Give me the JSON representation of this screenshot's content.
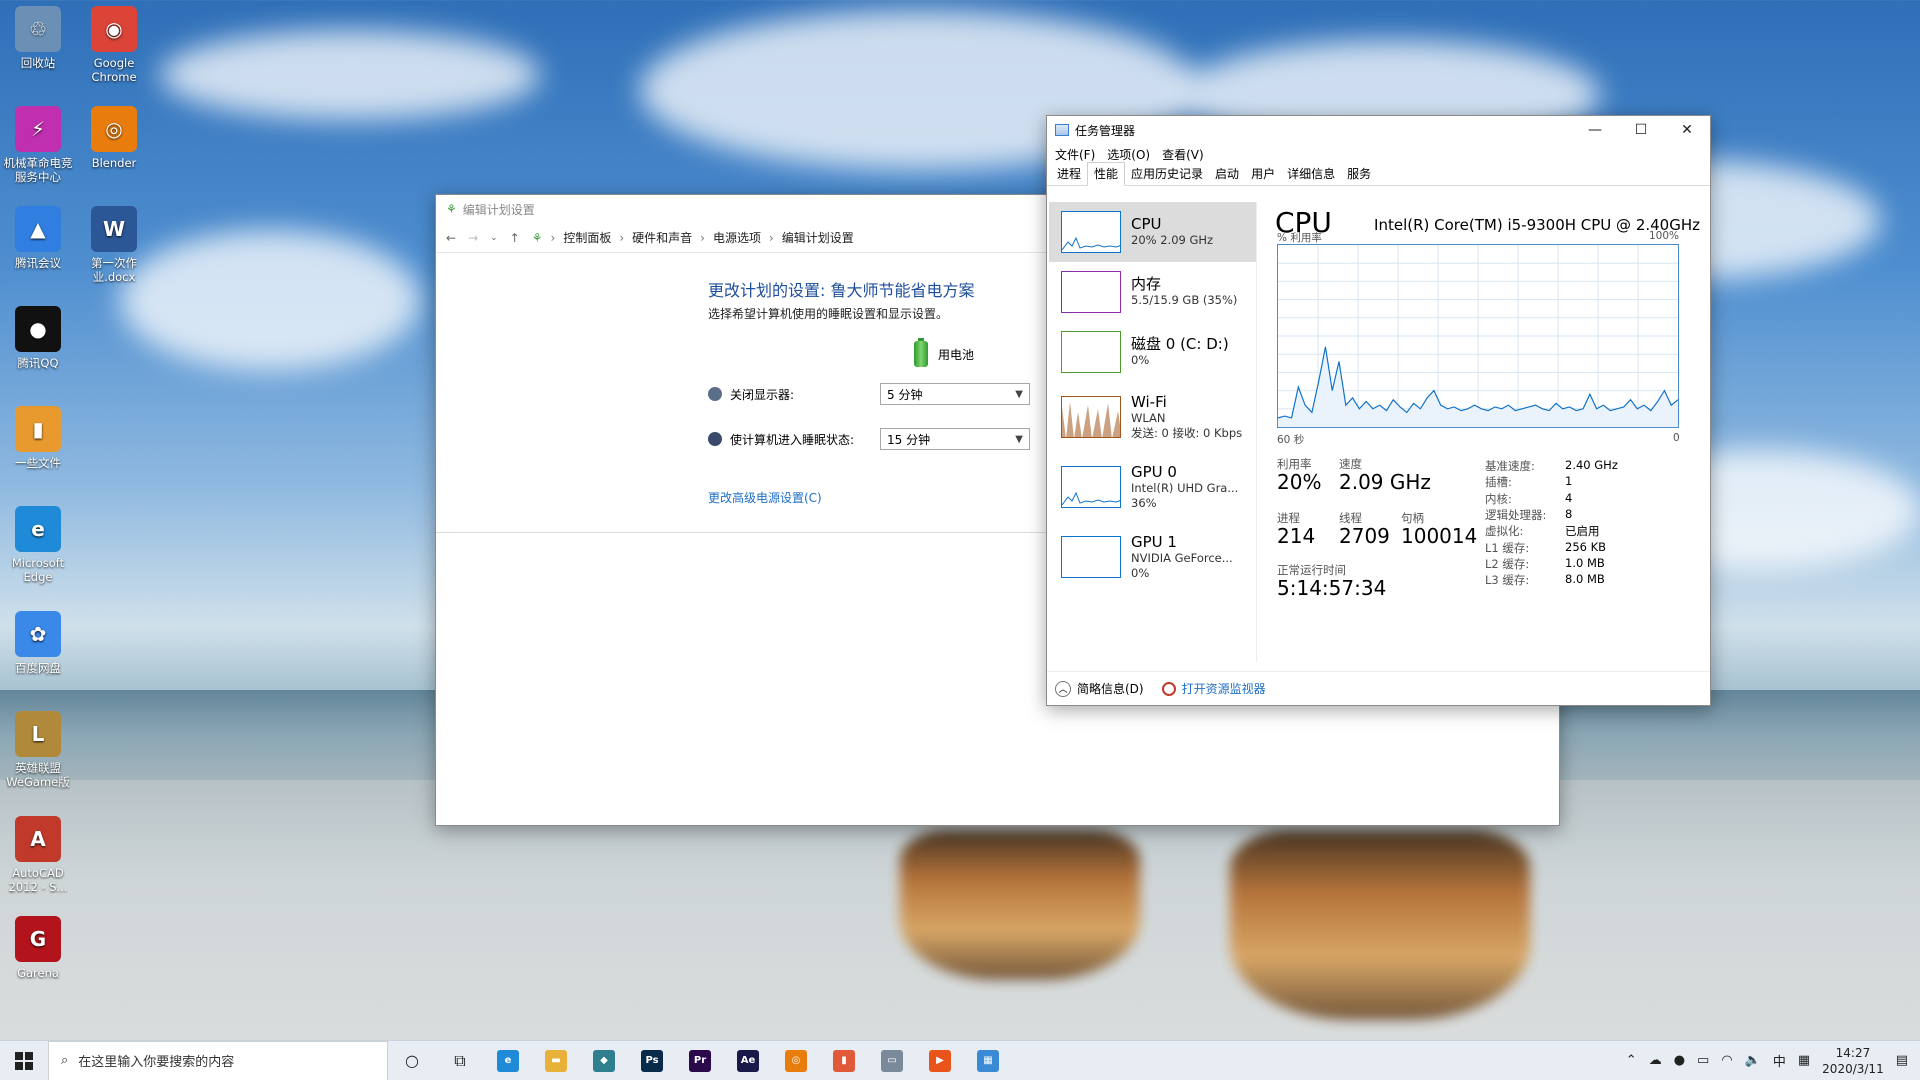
{
  "desktop": {
    "icons": [
      {
        "label": "回收站",
        "color": "#6b8fb5",
        "glyph": "♲"
      },
      {
        "label": "Google Chrome",
        "color": "#db4437",
        "glyph": "◉"
      },
      {
        "label": "机械革命电竞服务中心",
        "color": "#c02fb0",
        "glyph": "⚡"
      },
      {
        "label": "Blender",
        "color": "#e87d0d",
        "glyph": "◎"
      },
      {
        "label": "腾讯会议",
        "color": "#2f7ee0",
        "glyph": "▲"
      },
      {
        "label": "第一次作业.docx",
        "color": "#2b5797",
        "glyph": "W"
      },
      {
        "label": "腾讯QQ",
        "color": "#111111",
        "glyph": "●"
      },
      {
        "label": "一些文件",
        "color": "#e89a2f",
        "glyph": "▮"
      },
      {
        "label": "Microsoft Edge",
        "color": "#1f8ad8",
        "glyph": "e"
      },
      {
        "label": "百度网盘",
        "color": "#3a88e8",
        "glyph": "✿"
      },
      {
        "label": "英雄联盟WeGame版",
        "color": "#b08a3a",
        "glyph": "L"
      },
      {
        "label": "AutoCAD 2012 - S...",
        "color": "#c0392b",
        "glyph": "A"
      },
      {
        "label": "Garena",
        "color": "#b3141c",
        "glyph": "G"
      }
    ]
  },
  "power_window": {
    "title": "编辑计划设置",
    "breadcrumbs": [
      "控制面板",
      "硬件和声音",
      "电源选项",
      "编辑计划设置"
    ],
    "heading": "更改计划的设置: 鲁大师节能省电方案",
    "subheading": "选择希望计算机使用的睡眠设置和显示设置。",
    "battery_label": "用电池",
    "display_label": "关闭显示器:",
    "display_value": "5 分钟",
    "sleep_label": "使计算机进入睡眠状态:",
    "sleep_value": "15 分钟",
    "advanced_link": "更改高级电源设置(C)"
  },
  "task_manager": {
    "title": "任务管理器",
    "menu": [
      "文件(F)",
      "选项(O)",
      "查看(V)"
    ],
    "tabs": [
      "进程",
      "性能",
      "应用历史记录",
      "启动",
      "用户",
      "详细信息",
      "服务"
    ],
    "active_tab": "性能",
    "resources": [
      {
        "name": "CPU",
        "sub1": "20% 2.09 GHz",
        "sub2": "",
        "sub3": "",
        "color": "#1172c9"
      },
      {
        "name": "内存",
        "sub1": "5.5/15.9 GB (35%)",
        "sub2": "",
        "sub3": "",
        "color": "#8b2fa8"
      },
      {
        "name": "磁盘 0 (C: D:)",
        "sub1": "0%",
        "sub2": "",
        "sub3": "",
        "color": "#4d9a2f"
      },
      {
        "name": "Wi-Fi",
        "sub1": "WLAN",
        "sub2": "发送: 0 接收: 0 Kbps",
        "sub3": "",
        "color": "#a3541a"
      },
      {
        "name": "GPU 0",
        "sub1": "Intel(R) UHD Gra...",
        "sub2": "36%",
        "sub3": "",
        "color": "#1172c9"
      },
      {
        "name": "GPU 1",
        "sub1": "NVIDIA GeForce...",
        "sub2": "0%",
        "sub3": "",
        "color": "#1172c9"
      }
    ],
    "cpu": {
      "title": "CPU",
      "model": "Intel(R) Core(TM) i5-9300H CPU @ 2.40GHz",
      "y_label": "% 利用率",
      "y_max_label": "100%",
      "x_left_label": "60 秒",
      "x_right_label": "0",
      "utilization_label": "利用率",
      "utilization": "20%",
      "speed_label": "速度",
      "speed": "2.09 GHz",
      "processes_label": "进程",
      "processes": "214",
      "threads_label": "线程",
      "threads": "2709",
      "handles_label": "句柄",
      "handles": "100014",
      "uptime_label": "正常运行时间",
      "uptime": "5:14:57:34",
      "specs": [
        {
          "k": "基准速度:",
          "v": "2.40 GHz"
        },
        {
          "k": "插槽:",
          "v": "1"
        },
        {
          "k": "内核:",
          "v": "4"
        },
        {
          "k": "逻辑处理器:",
          "v": "8"
        },
        {
          "k": "虚拟化:",
          "v": "已启用"
        },
        {
          "k": "L1 缓存:",
          "v": "256 KB"
        },
        {
          "k": "L2 缓存:",
          "v": "1.0 MB"
        },
        {
          "k": "L3 缓存:",
          "v": "8.0 MB"
        }
      ],
      "history": [
        5,
        6,
        5,
        22,
        12,
        8,
        25,
        44,
        20,
        36,
        12,
        16,
        10,
        14,
        10,
        12,
        9,
        15,
        11,
        8,
        13,
        10,
        16,
        20,
        12,
        10,
        11,
        9,
        10,
        12,
        10,
        9,
        11,
        10,
        12,
        9,
        10,
        11,
        12,
        10,
        9,
        13,
        10,
        11,
        9,
        10,
        18,
        10,
        12,
        9,
        10,
        11,
        15,
        10,
        12,
        9,
        14,
        20,
        12,
        15
      ]
    },
    "footer_summary": "简略信息(D)",
    "footer_monitor": "打开资源监视器"
  },
  "taskbar": {
    "search_placeholder": "在这里输入你要搜索的内容",
    "time": "14:27",
    "date": "2020/3/11",
    "ime": "中",
    "apps": [
      {
        "name": "edge",
        "color": "#1f8ad8",
        "glyph": "e"
      },
      {
        "name": "explorer",
        "color": "#e8b23a",
        "glyph": "▬"
      },
      {
        "name": "app3",
        "color": "#2f7f8f",
        "glyph": "◆"
      },
      {
        "name": "photoshop",
        "color": "#0a2a4a",
        "glyph": "Ps"
      },
      {
        "name": "premiere",
        "color": "#2a0a4a",
        "glyph": "Pr"
      },
      {
        "name": "after-effects",
        "color": "#1a1a4a",
        "glyph": "Ae"
      },
      {
        "name": "blender",
        "color": "#e87d0d",
        "glyph": "◎"
      },
      {
        "name": "app8",
        "color": "#e05a3a",
        "glyph": "▮"
      },
      {
        "name": "app9",
        "color": "#7a8a9a",
        "glyph": "▭"
      },
      {
        "name": "app10",
        "color": "#e8541a",
        "glyph": "▶"
      },
      {
        "name": "task-manager",
        "color": "#3a8ad5",
        "glyph": "▦"
      }
    ]
  }
}
